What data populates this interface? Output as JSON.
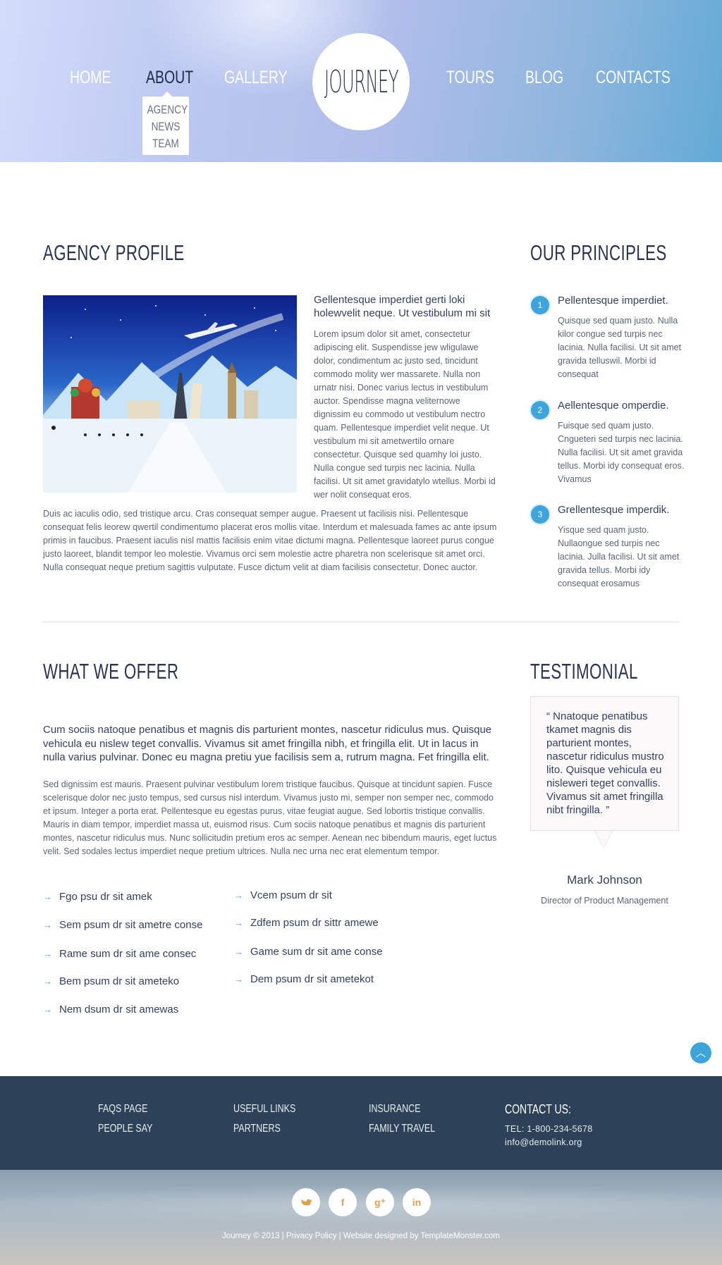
{
  "nav": {
    "items_left": [
      "HOME",
      "ABOUT",
      "GALLERY"
    ],
    "items_right": [
      "TOURS",
      "BLOG",
      "CONTACTS"
    ],
    "logo": "JOURNEY",
    "submenu": [
      "AGENCY",
      "NEWS",
      "TEAM"
    ]
  },
  "profile": {
    "heading": "AGENCY PROFILE",
    "lead": "Gellentesque imperdiet gerti loki holewvelit neque. Ut vestibulum mi sit",
    "body": "Lorem ipsum dolor sit amet, consectetur adipiscing elit. Suspendisse jew wligulawe dolor, condimentum ac justo sed, tincidunt commodo molity wer massarete. Nulla non urnatr nisi. Donec varius lectus in vestibulum auctor. Spendisse magna veliternowe dignissim eu commodo ut vestibulum nectro quam. Pellentesque imperdiet velit neque. Ut vestibulum mi sit ametwertilo ornare consectetur. Quisque sed quamhy loi justo. Nulla congue sed turpis nec lacinia. Nulla facilisi. Ut sit amet gravidatylo wtellus. Morbi id wer nolit consequat eros.",
    "wide": "Duis ac iaculis odio, sed tristique arcu. Cras consequat semper augue. Praesent ut facilisis nisi. Pellentesque consequat felis leorew qwertil condimentumo placerat eros mollis vitae. Interdum et malesuada fames ac ante ipsum primis in faucibus. Praesent iaculis nisl mattis facilisis enim vitae dictumi magna. Pellentesque laoreet purus congue justo laoreet, blandit tempor leo molestie. Vivamus orci sem molestie actre pharetra non scelerisque sit amet orci. Nulla consequat neque pretium sagittis vulputate. Fusce dictum velit at diam facilisis consectetur. Donec auctor."
  },
  "principles": {
    "heading": "OUR PRINCIPLES",
    "items": [
      {
        "num": "1",
        "title": "Pellentesque imperdiet.",
        "text": "Quisque sed quam justo. Nulla kilor congue sed turpis nec lacinia. Nulla facilisi. Ut sit amet gravida telluswil. Morbi id consequat"
      },
      {
        "num": "2",
        "title": "Aellentesque omperdie.",
        "text": "Fuisque sed quam justo. Cngueteri sed turpis nec lacinia. Nulla facilisi. Ut sit amet gravida tellus. Morbi idy consequat eros. Vivamus"
      },
      {
        "num": "3",
        "title": "Grellentesque imperdik.",
        "text": "Yisque sed quam justo. Nullaongue sed turpis nec lacinia. Julla facilisi. Ut sit amet gravida tellus. Morbi idy consequat erosamus"
      }
    ]
  },
  "offer": {
    "heading": "WHAT WE OFFER",
    "lead": "Cum sociis natoque penatibus et magnis dis parturient montes, nascetur ridiculus mus. Quisque vehicula eu nislew teget convallis. Vivamus sit amet fringilla nibh, et fringilla elit. Ut in lacus in nulla varius pulvinar. Donec eu magna pretiu yue facilisis sem a, rutrum magna.  Fet fringilla elit.",
    "body": "Sed dignissim est mauris. Praesent pulvinar vestibulum lorem tristique faucibus. Quisque at tincidunt sapien. Fusce scelerisque dolor nec justo tempus, sed cursus nisl interdum. Vivamus justo mi, semper non semper nec, commodo et ipsum. Integer a porta erat. Pellentesque eu egestas purus, vitae feugiat augue. Sed lobortis tristique convallis. Mauris in diam tempor, imperdiet massa ut, euismod risus. Cum sociis natoque penatibus et magnis dis parturient montes, nascetur ridiculus mus. Nunc sollicitudin pretium eros ac semper. Aenean nec bibendum mauris, eget luctus velit. Sed sodales lectus imperdiet neque pretium ultrices. Nulla nec urna nec erat elementum tempor.",
    "list_left": [
      "Fgo psu dr sit amek",
      "Sem psum dr sit ametre conse",
      "Rame sum dr sit ame consec",
      "Bem psum dr sit ameteko",
      "Nem dsum dr sit amewas"
    ],
    "list_right": [
      "Vcem psum dr sit",
      "Zdfem psum dr sittr amewe",
      "Game sum dr sit ame conse",
      "Dem psum dr sit ametekot"
    ]
  },
  "testimonial": {
    "heading": "TESTIMONIAL",
    "quote": "“ Nnatoque penatibus tkamet magnis dis parturient montes, nascetur ridiculus mustro lito. Quisque vehicula eu nisleweri teget convallis. Vivamus sit amet fringilla nibt fringilla. ”",
    "name": "Mark Johnson",
    "role": "Director of Product Management"
  },
  "footer": {
    "col1": [
      "FAQS PAGE",
      "PEOPLE SAY"
    ],
    "col2": [
      "USEFUL LINKS",
      "PARTNERS"
    ],
    "col3": [
      "INSURANCE",
      "FAMILY TRAVEL"
    ],
    "contact_heading": "CONTACT US:",
    "tel": "TEL: 1-800-234-5678",
    "email": "info@demolink.org",
    "social": [
      "twitter",
      "facebook",
      "google-plus",
      "linkedin"
    ],
    "copyright": "Journey © 2013 | Privacy Policy | Website designed by TemplateMonster.com"
  },
  "colors": {
    "accent": "#3da4dc",
    "heading": "#2a3450",
    "footer_bg": "#2d4258"
  }
}
